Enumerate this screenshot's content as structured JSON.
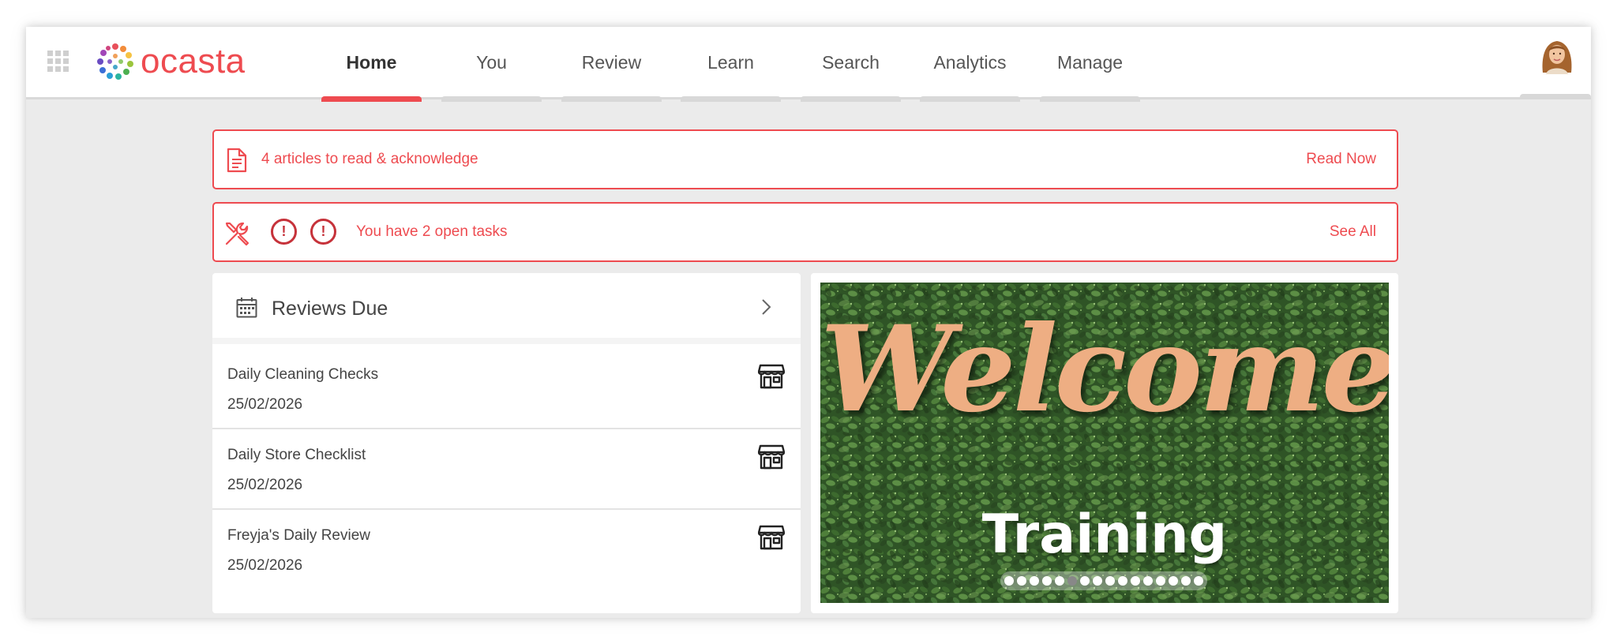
{
  "app": {
    "brand": "ocasta"
  },
  "nav": {
    "tabs": [
      {
        "label": "Home",
        "active": true
      },
      {
        "label": "You",
        "active": false
      },
      {
        "label": "Review",
        "active": false
      },
      {
        "label": "Learn",
        "active": false
      },
      {
        "label": "Search",
        "active": false
      },
      {
        "label": "Analytics",
        "active": false
      },
      {
        "label": "Manage",
        "active": false
      }
    ]
  },
  "articles_banner": {
    "icon": "document-icon",
    "text": "4 articles to read & acknowledge",
    "action": "Read Now"
  },
  "tasks_banner": {
    "icon": "tools-icon",
    "alerts": [
      "!",
      "!"
    ],
    "text": "You have 2 open tasks",
    "action": "See All"
  },
  "reviews": {
    "title": "Reviews Due",
    "items": [
      {
        "name": "Daily Cleaning Checks",
        "date": "25/02/2026",
        "icon": "store-icon"
      },
      {
        "name": "Daily Store Checklist",
        "date": "25/02/2026",
        "icon": "store-icon"
      },
      {
        "name": "Freyja's Daily Review",
        "date": "25/02/2026",
        "icon": "store-icon"
      }
    ]
  },
  "carousel": {
    "headline": "Welcome",
    "caption": "Training",
    "slide_count": 16,
    "active_slide": 5
  },
  "colors": {
    "accent": "#ee4b50",
    "alert": "#c6323a",
    "background": "#ebebeb"
  }
}
